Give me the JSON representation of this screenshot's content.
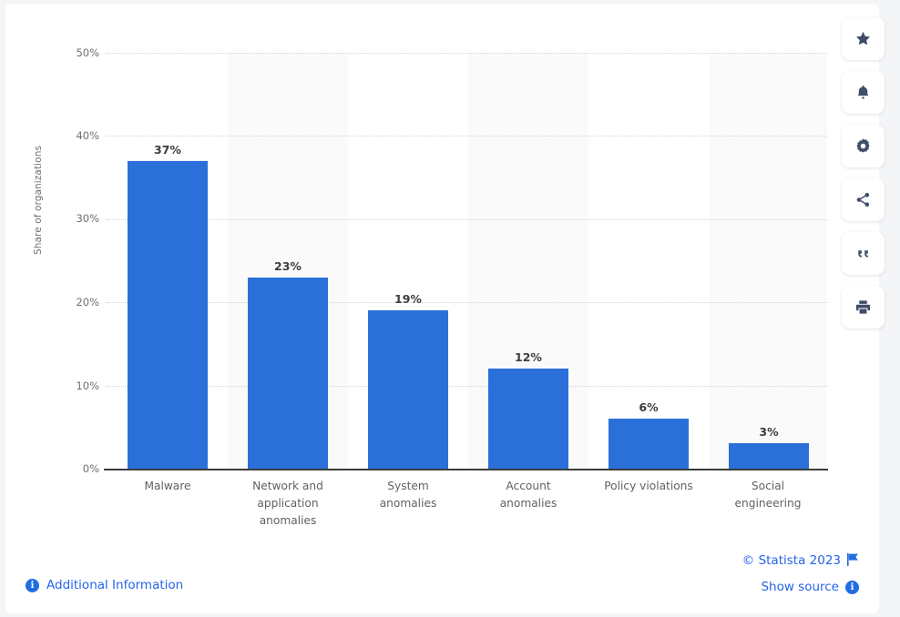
{
  "chart_data": {
    "type": "bar",
    "title": "",
    "subtitle": "",
    "xlabel": "",
    "ylabel": "Share of organizations",
    "ylim": [
      0,
      50
    ],
    "grid": true,
    "legend": null,
    "categories": [
      "Malware",
      "Network and application anomalies",
      "System anomalies",
      "Account anomalies",
      "Policy violations",
      "Social engineering"
    ],
    "category_lines": [
      [
        "Malware"
      ],
      [
        "Network and",
        "application",
        "anomalies"
      ],
      [
        "System",
        "anomalies"
      ],
      [
        "Account",
        "anomalies"
      ],
      [
        "Policy violations"
      ],
      [
        "Social",
        "engineering"
      ]
    ],
    "values": [
      37,
      23,
      19,
      12,
      6,
      3
    ],
    "value_labels": [
      "37%",
      "23%",
      "19%",
      "12%",
      "6%",
      "3%"
    ],
    "ytick_labels": [
      "50%",
      "40%",
      "30%",
      "20%",
      "10%",
      "0%"
    ],
    "ytick_values": [
      50,
      40,
      30,
      20,
      10,
      0
    ],
    "bar_color": "#2a70d8",
    "band_color": "#fafafa",
    "axis_color": "#3c3c3c"
  },
  "footer": {
    "additional_information": "Additional Information",
    "copyright": "© Statista 2023",
    "show_source": "Show source",
    "info_glyph": "i"
  },
  "toolbar": {
    "items": [
      {
        "name": "favorite-star",
        "label": "Favorite"
      },
      {
        "name": "notification-bell",
        "label": "Notifications"
      },
      {
        "name": "settings-gear",
        "label": "Settings"
      },
      {
        "name": "share",
        "label": "Share"
      },
      {
        "name": "citation-quote",
        "label": "Cite"
      },
      {
        "name": "print",
        "label": "Print"
      }
    ]
  }
}
